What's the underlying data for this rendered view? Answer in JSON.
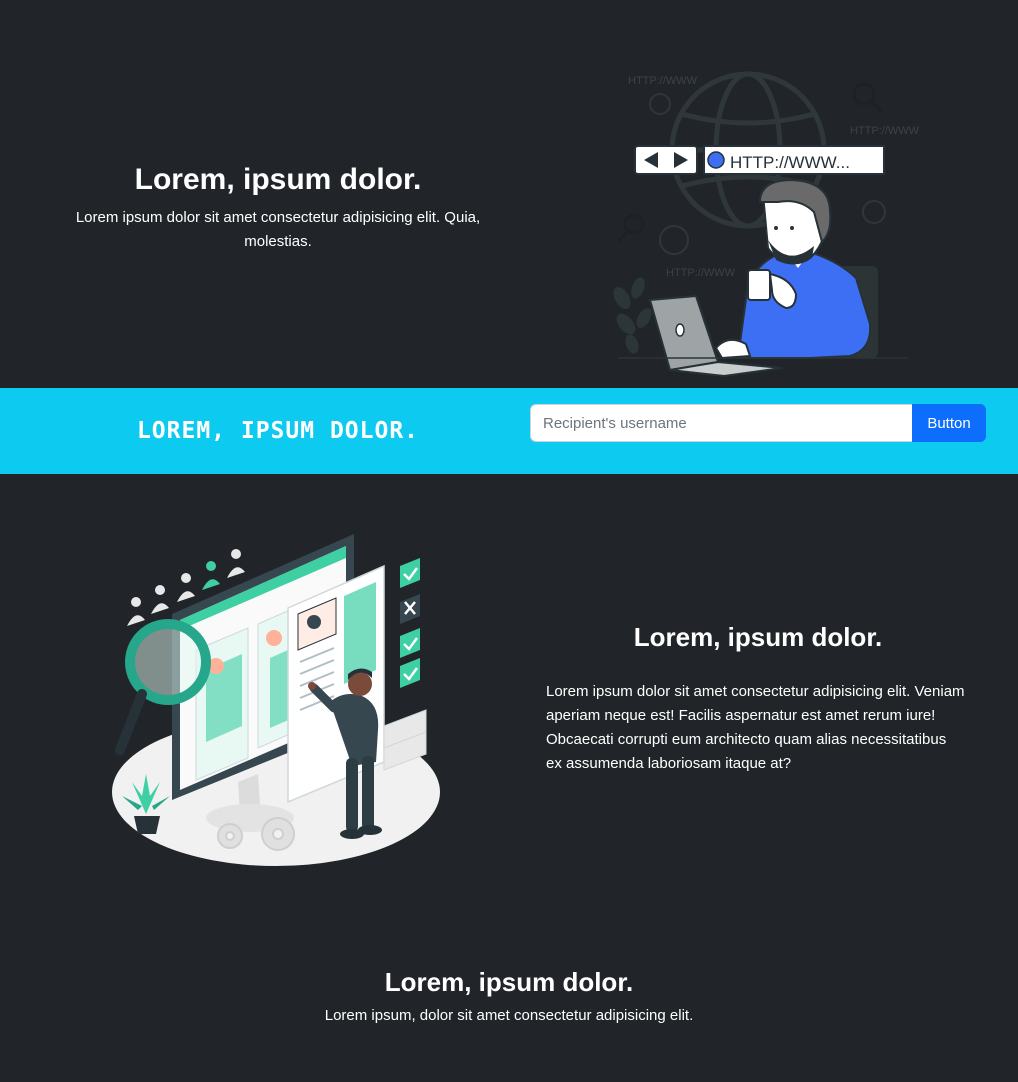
{
  "hero": {
    "title": "Lorem, ipsum dolor.",
    "description": "Lorem ipsum dolor sit amet consectetur adipisicing elit. Quia, molestias.",
    "illustration": {
      "url_bar_text": "HTTP://WWW...",
      "bg_label_1": "HTTP://WWW",
      "bg_label_2": "HTTP://WWW",
      "bg_label_3": "HTTP://WWW",
      "accent_color": "#3d6ff5"
    }
  },
  "band": {
    "title": "LOREM, IPSUM DOLOR.",
    "input_placeholder": "Recipient's username",
    "input_value": "",
    "button_label": "Button",
    "background_color": "#0dcaf0",
    "button_color": "#0d6efd"
  },
  "feature": {
    "title": "Lorem, ipsum dolor.",
    "description": "Lorem ipsum dolor sit amet consectetur adipisicing elit. Veniam aperiam neque est! Facilis aspernatur est amet rerum iure! Obcaecati corrupti eum architecto quam alias necessitatibus ex assumenda laboriosam itaque at?",
    "accent_color": "#3ecfa3"
  },
  "footer": {
    "title": "Lorem, ipsum dolor.",
    "description": "Lorem ipsum, dolor sit amet consectetur adipisicing elit."
  }
}
